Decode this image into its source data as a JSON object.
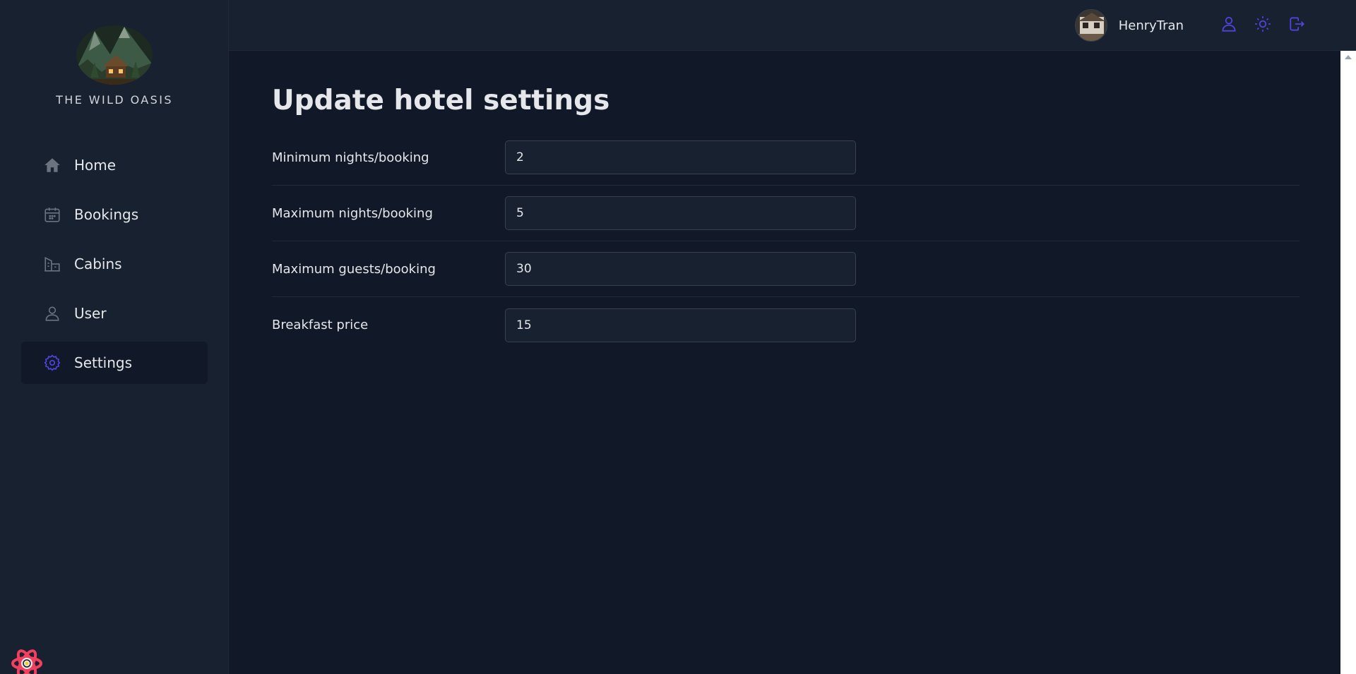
{
  "brand": {
    "name": "THE WILD OASIS",
    "logo_icon": "mountain-cabin-logo"
  },
  "sidebar": {
    "items": [
      {
        "label": "Home",
        "icon": "home-icon",
        "active": false
      },
      {
        "label": "Bookings",
        "icon": "calendar-icon",
        "active": false
      },
      {
        "label": "Cabins",
        "icon": "building-icon",
        "active": false
      },
      {
        "label": "User",
        "icon": "user-icon",
        "active": false
      },
      {
        "label": "Settings",
        "icon": "gear-icon",
        "active": true
      }
    ]
  },
  "header": {
    "user_name": "HenryTran",
    "actions": [
      {
        "icon": "user-icon"
      },
      {
        "icon": "sun-icon"
      },
      {
        "icon": "logout-icon"
      }
    ]
  },
  "page": {
    "title": "Update hotel settings"
  },
  "settings": {
    "fields": [
      {
        "label": "Minimum nights/booking",
        "value": "2"
      },
      {
        "label": "Maximum nights/booking",
        "value": "5"
      },
      {
        "label": "Maximum guests/booking",
        "value": "30"
      },
      {
        "label": "Breakfast price",
        "value": "15"
      }
    ]
  },
  "colors": {
    "accent": "#4f46e5",
    "sidebar_bg": "#18212f",
    "main_bg": "#111827",
    "react_badge": "#f43f5e"
  }
}
